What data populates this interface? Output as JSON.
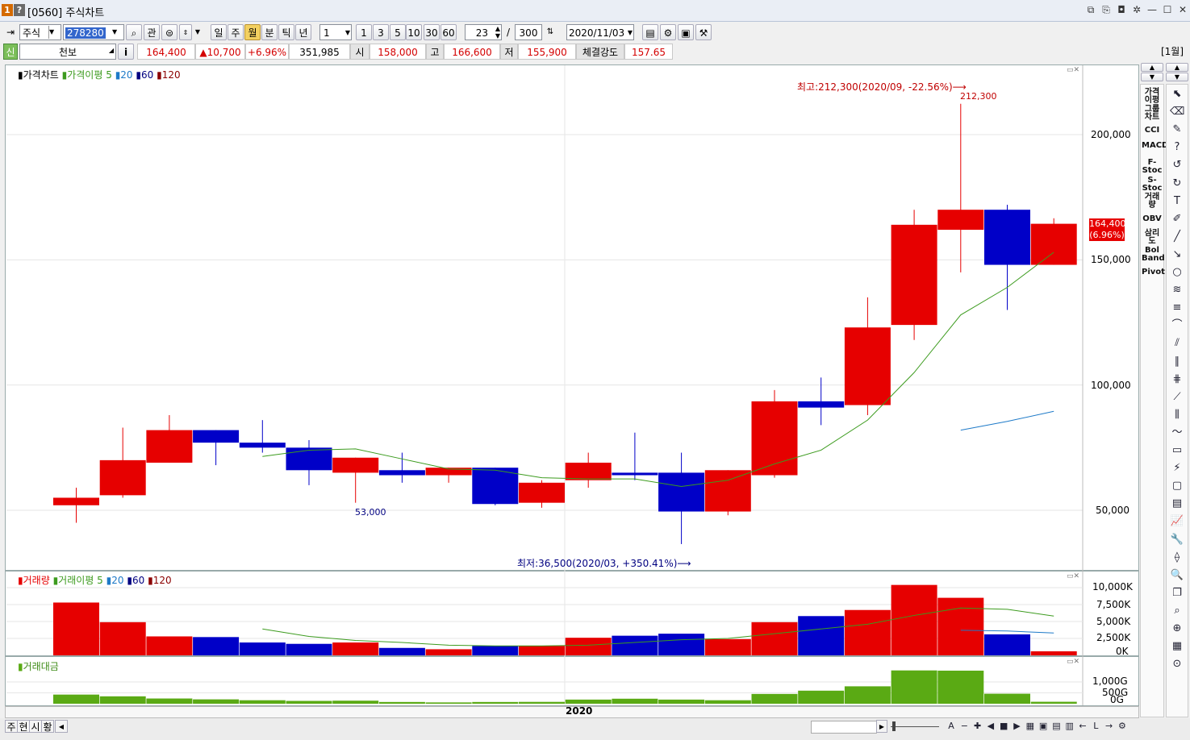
{
  "window": {
    "badge1": "1",
    "badge2": "?",
    "title": "[0560] 주식차트"
  },
  "toolbar": {
    "market": "주식",
    "code": "278280",
    "search_label": "관",
    "period_buttons": [
      "일",
      "주",
      "월",
      "분",
      "틱",
      "년"
    ],
    "active_period": "월",
    "unit_select": "1",
    "quick_units": [
      "1",
      "3",
      "5",
      "10",
      "30",
      "60"
    ],
    "count_value": "23",
    "count_sep": "/",
    "count_total": "300",
    "date_value": "2020/11/03"
  },
  "quote": {
    "credit_tag": "신",
    "name": "천보",
    "info": "i",
    "price": "164,400",
    "change": "▲10,700",
    "change_rate": "+6.96%",
    "volume": "351,985",
    "open_label": "시",
    "open": "158,000",
    "high_label": "고",
    "high": "166,600",
    "low_label": "저",
    "low": "155,900",
    "strength_label": "체결강도",
    "strength": "157.65",
    "period_tag": "[1월]"
  },
  "price_pane": {
    "legend": [
      "가격차트",
      "가격이평",
      "5",
      "20",
      "60",
      "120"
    ],
    "max_annotation": "최고:212,300(2020/09, -22.56%)⟶",
    "max_label": "212,300",
    "min_annotation": "최저:36,500(2020/03, +350.41%)⟶",
    "low_label": "53,000",
    "current_price_tag": "164,400",
    "current_rate_tag": "(6.96%)",
    "y_ticks": [
      "200,000",
      "150,000",
      "100,000",
      "50,000"
    ]
  },
  "volume_pane": {
    "legend": [
      "거래량",
      "거래이평",
      "5",
      "20",
      "60",
      "120"
    ],
    "y_ticks": [
      "10,000K",
      "7,500K",
      "5,000K",
      "2,500K",
      "0K"
    ]
  },
  "amount_pane": {
    "legend": [
      "거래대금"
    ],
    "y_ticks": [
      "1,000G",
      "500G",
      "0G"
    ]
  },
  "x_axis_label": "2020",
  "right_tools": [
    "가격이평",
    "그룹차트",
    "CCI",
    "MACD",
    "F-Stoc",
    "S-Stoc",
    "거래량",
    "OBV",
    "삼리도",
    "Bol Band",
    "Pivot"
  ],
  "bottom": {
    "tabs": [
      "주",
      "현",
      "시",
      "황"
    ]
  },
  "colors": {
    "up": "#e60000",
    "down": "#0000c8",
    "ma5": "#3c9b1e",
    "ma20": "#1e7ac8",
    "amount": "#5aaa14",
    "annotation": "#c00000"
  },
  "chart_data": {
    "type": "candlestick",
    "interval": "monthly",
    "x_year_label": "2020",
    "ylim": [
      30000,
      220000
    ],
    "candles": [
      {
        "open": 52000,
        "high": 59000,
        "low": 45000,
        "close": 55000
      },
      {
        "open": 56000,
        "high": 83000,
        "low": 55000,
        "close": 70000
      },
      {
        "open": 69000,
        "high": 88000,
        "low": 69000,
        "close": 82000
      },
      {
        "open": 82000,
        "high": 82000,
        "low": 68000,
        "close": 77000
      },
      {
        "open": 77000,
        "high": 86000,
        "low": 73000,
        "close": 75000
      },
      {
        "open": 75000,
        "high": 78000,
        "low": 60000,
        "close": 66000
      },
      {
        "open": 65000,
        "high": 71000,
        "low": 53000,
        "close": 71000
      },
      {
        "open": 66000,
        "high": 73000,
        "low": 61000,
        "close": 64000
      },
      {
        "open": 64000,
        "high": 67000,
        "low": 61000,
        "close": 67000
      },
      {
        "open": 67000,
        "high": 67000,
        "low": 52000,
        "close": 52500
      },
      {
        "open": 53000,
        "high": 62000,
        "low": 51000,
        "close": 61000
      },
      {
        "open": 62000,
        "high": 73000,
        "low": 59000,
        "close": 69000
      },
      {
        "open": 65000,
        "high": 81000,
        "low": 62000,
        "close": 64000
      },
      {
        "open": 65000,
        "high": 73000,
        "low": 36500,
        "close": 49500
      },
      {
        "open": 49500,
        "high": 66000,
        "low": 48000,
        "close": 66000
      },
      {
        "open": 64000,
        "high": 98000,
        "low": 63000,
        "close": 93500
      },
      {
        "open": 93500,
        "high": 103000,
        "low": 84000,
        "close": 91000
      },
      {
        "open": 92000,
        "high": 135000,
        "low": 88000,
        "close": 123000
      },
      {
        "open": 124000,
        "high": 170000,
        "low": 118000,
        "close": 164000
      },
      {
        "open": 162000,
        "high": 212300,
        "low": 145000,
        "close": 170000
      },
      {
        "open": 170000,
        "high": 172000,
        "low": 130000,
        "close": 148000
      },
      {
        "open": 148000,
        "high": 166600,
        "low": 148000,
        "close": 164400
      }
    ],
    "ma5": [
      null,
      null,
      null,
      null,
      71500,
      74000,
      74500,
      70500,
      66500,
      66000,
      63000,
      62500,
      62500,
      59500,
      62000,
      68500,
      74000,
      86000,
      105000,
      128000,
      139000,
      153000
    ],
    "ma20": [
      null,
      null,
      null,
      null,
      null,
      null,
      null,
      null,
      null,
      null,
      null,
      null,
      null,
      null,
      null,
      null,
      null,
      null,
      null,
      82000,
      85500,
      89500
    ],
    "volume_k": [
      7800,
      4900,
      2800,
      2700,
      1900,
      1700,
      1900,
      1100,
      900,
      1400,
      1400,
      2600,
      2900,
      3200,
      2400,
      4900,
      5800,
      6700,
      10400,
      8500,
      3100,
      600
    ],
    "volume_ma5": [
      null,
      null,
      null,
      null,
      3900,
      2800,
      2200,
      1900,
      1500,
      1400,
      1400,
      1500,
      1900,
      2300,
      2500,
      3200,
      3900,
      4600,
      5900,
      7000,
      6800,
      5800
    ],
    "volume_ma20": [
      null,
      null,
      null,
      null,
      null,
      null,
      null,
      null,
      null,
      null,
      null,
      null,
      null,
      null,
      null,
      null,
      null,
      null,
      null,
      3700,
      3600,
      3300
    ],
    "volume_ylim": [
      0,
      10000
    ],
    "amount_g": [
      420,
      340,
      240,
      200,
      160,
      130,
      140,
      80,
      60,
      80,
      85,
      190,
      230,
      190,
      160,
      450,
      600,
      800,
      1530,
      1520,
      460,
      90
    ],
    "amount_ylim": [
      0,
      1000
    ]
  }
}
